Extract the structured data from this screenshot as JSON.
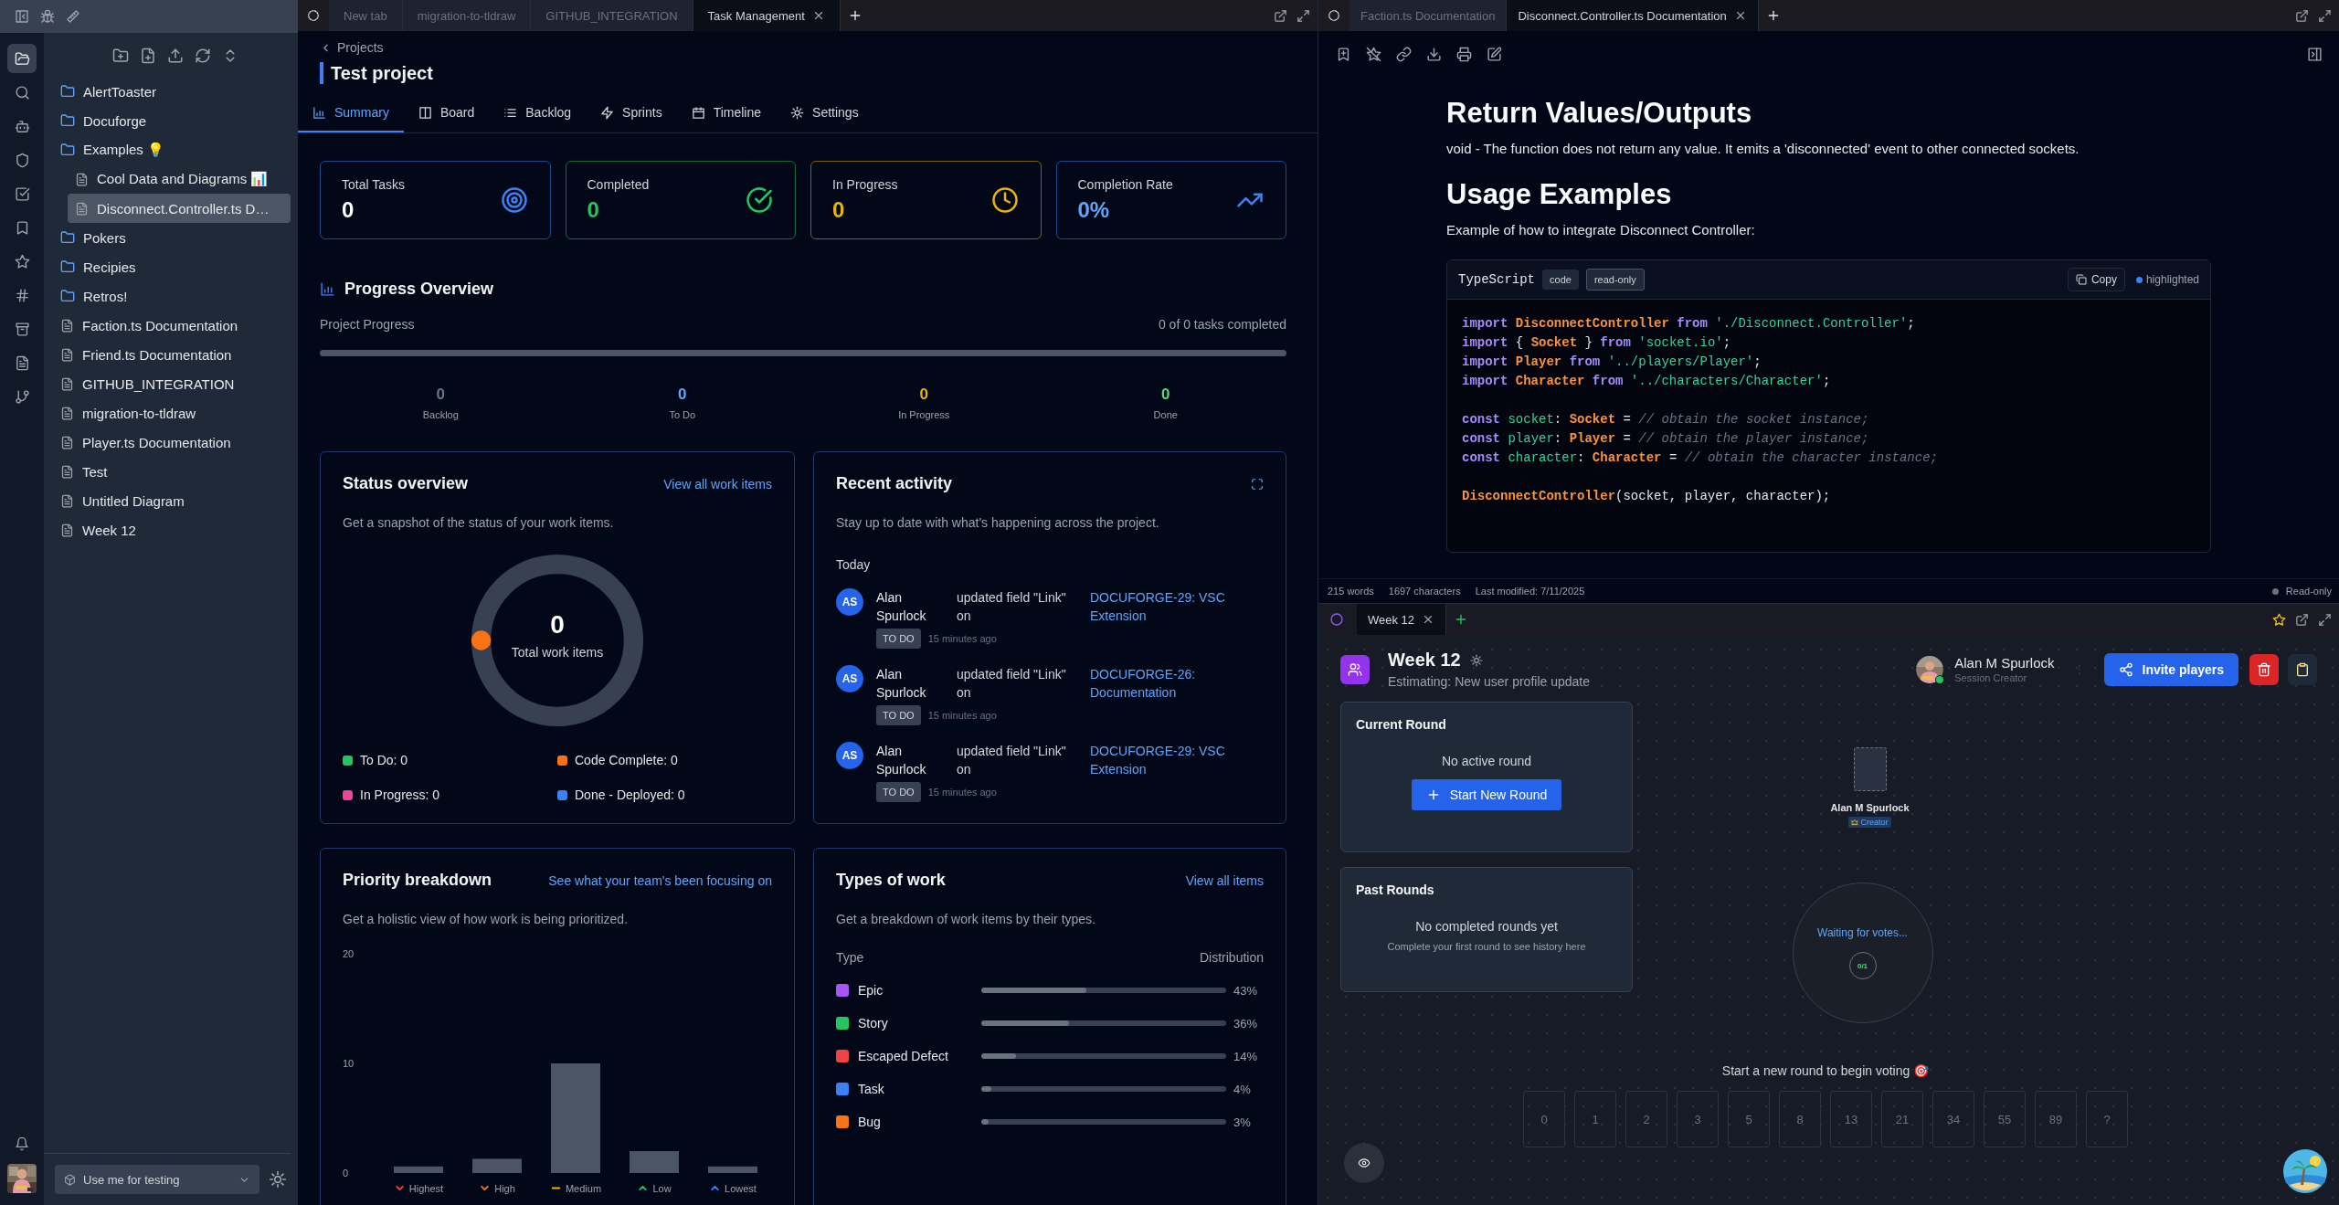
{
  "rail_items": [
    {
      "kind": "files",
      "selected": true
    },
    {
      "kind": "search",
      "selected": false
    },
    {
      "kind": "bot",
      "selected": false
    },
    {
      "kind": "shield",
      "selected": false
    },
    {
      "kind": "tasks",
      "selected": false
    },
    {
      "kind": "bookmark",
      "selected": false
    },
    {
      "kind": "star",
      "selected": false
    },
    {
      "kind": "tags",
      "selected": false
    },
    {
      "kind": "archive",
      "selected": false
    },
    {
      "kind": "document",
      "selected": false
    },
    {
      "kind": "branch",
      "selected": false
    }
  ],
  "sidebar": {
    "tree": [
      {
        "label": "AlertToaster",
        "kind": "folder",
        "selected": false
      },
      {
        "label": "Docuforge",
        "kind": "folder",
        "selected": false
      },
      {
        "label": "Examples 💡",
        "kind": "folder",
        "selected": false,
        "children": [
          {
            "label": "Cool Data and Diagrams 📊",
            "kind": "file",
            "selected": false
          },
          {
            "label": "Disconnect.Controller.ts D…",
            "kind": "file",
            "selected": true
          }
        ]
      },
      {
        "label": "Pokers",
        "kind": "folder",
        "selected": false
      },
      {
        "label": "Recipies",
        "kind": "folder",
        "selected": false
      },
      {
        "label": "Retros!",
        "kind": "folder",
        "selected": false
      },
      {
        "label": "Faction.ts Documentation",
        "kind": "file",
        "selected": false
      },
      {
        "label": "Friend.ts Documentation",
        "kind": "file",
        "selected": false
      },
      {
        "label": "GITHUB_INTEGRATION",
        "kind": "file",
        "selected": false
      },
      {
        "label": "migration-to-tldraw",
        "kind": "file",
        "selected": false
      },
      {
        "label": "Player.ts Documentation",
        "kind": "file",
        "selected": false
      },
      {
        "label": "Test",
        "kind": "file",
        "selected": false
      },
      {
        "label": "Untitled Diagram",
        "kind": "file",
        "selected": false
      },
      {
        "label": "Week 12",
        "kind": "file",
        "selected": false
      }
    ],
    "workspace": "Use me for testing"
  },
  "task_pane": {
    "tabs": [
      {
        "label": "New tab",
        "selected": false
      },
      {
        "label": "migration-to-tldraw",
        "selected": false
      },
      {
        "label": "GITHUB_INTEGRATION",
        "selected": false
      },
      {
        "label": "Task Management",
        "selected": true
      }
    ],
    "breadcrumb": "Projects",
    "title": "Test project",
    "nav": [
      {
        "label": "Summary",
        "kind": "chart",
        "selected": true
      },
      {
        "label": "Board",
        "kind": "board",
        "selected": false
      },
      {
        "label": "Backlog",
        "kind": "list",
        "selected": false
      },
      {
        "label": "Sprints",
        "kind": "zap",
        "selected": false
      },
      {
        "label": "Timeline",
        "kind": "calendar",
        "selected": false
      },
      {
        "label": "Settings",
        "kind": "gear",
        "selected": false
      }
    ],
    "stats": [
      {
        "label": "Total Tasks",
        "value": "0",
        "kind": "target",
        "color": "#3b82f6"
      },
      {
        "label": "Completed",
        "value": "0",
        "kind": "check",
        "color": "#22c55e"
      },
      {
        "label": "In Progress",
        "value": "0",
        "kind": "clock",
        "color": "#eab308"
      },
      {
        "label": "Completion Rate",
        "value": "0%",
        "kind": "trend",
        "color": "#3b82f6"
      }
    ],
    "progress": {
      "title": "Progress Overview",
      "label": "Project Progress",
      "summary": "0 of 0 tasks completed",
      "level": 0,
      "counts": [
        {
          "value": "0",
          "label": "Backlog",
          "color": "#6b7280"
        },
        {
          "value": "0",
          "label": "To Do",
          "color": "#60a5fa"
        },
        {
          "value": "0",
          "label": "In Progress",
          "color": "#eab308"
        },
        {
          "value": "0",
          "label": "Done",
          "color": "#4ade80"
        }
      ]
    },
    "status_overview": {
      "title": "Status overview",
      "link": "View all work items",
      "subtitle": "Get a snapshot of the status of your work items.",
      "total": "0",
      "total_label": "Total work items",
      "legend": [
        {
          "label": "To Do: 0",
          "color": "#22c55e"
        },
        {
          "label": "Code Complete: 0",
          "color": "#f97316"
        },
        {
          "label": "In Progress: 0",
          "color": "#ec4899"
        },
        {
          "label": "Done - Deployed: 0",
          "color": "#3b82f6"
        }
      ]
    },
    "recent_activity": {
      "title": "Recent activity",
      "subtitle": "Stay up to date with what's happening across the project.",
      "day": "Today",
      "items": [
        {
          "initials": "AS",
          "user": "Alan Spurlock",
          "action": "updated field \"Link\" on",
          "target": "DOCUFORGE-29: VSC Extension",
          "status": "TO DO",
          "time": "15 minutes ago"
        },
        {
          "initials": "AS",
          "user": "Alan Spurlock",
          "action": "updated field \"Link\" on",
          "target": "DOCUFORGE-26: Documentation",
          "status": "TO DO",
          "time": "15 minutes ago"
        },
        {
          "initials": "AS",
          "user": "Alan Spurlock",
          "action": "updated field \"Link\" on",
          "target": "DOCUFORGE-29: VSC Extension",
          "status": "TO DO",
          "time": "15 minutes ago"
        }
      ]
    },
    "priority_breakdown": {
      "title": "Priority breakdown",
      "link": "See what your team's been focusing on",
      "subtitle": "Get a holistic view of how work is being prioritized.",
      "chart_data": {
        "type": "bar",
        "categories": [
          "Highest",
          "High",
          "Medium",
          "Low",
          "Lowest"
        ],
        "values": [
          0.6,
          1.3,
          10,
          2,
          0.6
        ],
        "ylim": [
          0,
          20
        ],
        "yticks": [
          0,
          10,
          20
        ]
      },
      "markers": [
        {
          "kind": "down",
          "color": "#ef4444"
        },
        {
          "kind": "down",
          "color": "#f97316"
        },
        {
          "kind": "flat",
          "color": "#eab308"
        },
        {
          "kind": "up",
          "color": "#22c55e"
        },
        {
          "kind": "up",
          "color": "#3b82f6"
        }
      ]
    },
    "types_of_work": {
      "title": "Types of work",
      "link": "View all items",
      "subtitle": "Get a breakdown of work items by their types.",
      "type_heading": "Type",
      "distribution_heading": "Distribution",
      "rows": [
        {
          "label": "Epic",
          "color": "#a855f7",
          "level": 0.43,
          "reading": "43%"
        },
        {
          "label": "Story",
          "color": "#22c55e",
          "level": 0.36,
          "reading": "36%"
        },
        {
          "label": "Escaped Defect",
          "color": "#ef4444",
          "level": 0.14,
          "reading": "14%"
        },
        {
          "label": "Task",
          "color": "#3b82f6",
          "level": 0.04,
          "reading": "4%"
        },
        {
          "label": "Bug",
          "color": "#f97316",
          "level": 0.03,
          "reading": "3%"
        }
      ]
    }
  },
  "doc_pane": {
    "tabs": [
      {
        "label": "Faction.ts Documentation",
        "selected": false
      },
      {
        "label": "Disconnect.Controller.ts Documentation",
        "selected": true
      }
    ],
    "blocks": [
      {
        "kind": "heading",
        "text": "Return Values/Outputs"
      },
      {
        "kind": "paragraph",
        "text": "void - The function does not return any value. It emits a 'disconnected' event to other connected sockets."
      },
      {
        "kind": "heading",
        "text": "Usage Examples"
      },
      {
        "kind": "paragraph",
        "text": "Example of how to integrate Disconnect Controller:"
      }
    ],
    "code": {
      "language": "TypeScript",
      "badges": [
        {
          "label": "code",
          "kind": "filled"
        },
        {
          "label": "read-only",
          "kind": "outlined"
        }
      ],
      "copy": "Copy",
      "status": "highlighted",
      "groups": [
        [
          [
            {
              "kind": "keyword",
              "text": "import "
            },
            {
              "kind": "type",
              "text": "DisconnectController "
            },
            {
              "kind": "keyword",
              "text": "from "
            },
            {
              "kind": "string",
              "text": "'./Disconnect.Controller'"
            },
            {
              "kind": "plain",
              "text": ";"
            }
          ],
          [
            {
              "kind": "keyword",
              "text": "import"
            },
            {
              "kind": "plain",
              "text": " { "
            },
            {
              "kind": "type",
              "text": "Socket"
            },
            {
              "kind": "plain",
              "text": " } "
            },
            {
              "kind": "keyword",
              "text": "from "
            },
            {
              "kind": "string",
              "text": "'socket.io'"
            },
            {
              "kind": "plain",
              "text": ";"
            }
          ],
          [
            {
              "kind": "keyword",
              "text": "import "
            },
            {
              "kind": "type",
              "text": "Player "
            },
            {
              "kind": "keyword",
              "text": "from "
            },
            {
              "kind": "string",
              "text": "'../players/Player'"
            },
            {
              "kind": "plain",
              "text": ";"
            }
          ],
          [
            {
              "kind": "keyword",
              "text": "import "
            },
            {
              "kind": "type",
              "text": "Character "
            },
            {
              "kind": "keyword",
              "text": "from "
            },
            {
              "kind": "string",
              "text": "'../characters/Character'"
            },
            {
              "kind": "plain",
              "text": ";"
            }
          ]
        ],
        [
          [
            {
              "kind": "keyword",
              "text": "const "
            },
            {
              "kind": "variable",
              "text": "socket"
            },
            {
              "kind": "plain",
              "text": ": "
            },
            {
              "kind": "type",
              "text": "Socket"
            },
            {
              "kind": "plain",
              "text": " = "
            },
            {
              "kind": "comment",
              "text": "// obtain the socket instance;"
            }
          ],
          [
            {
              "kind": "keyword",
              "text": "const "
            },
            {
              "kind": "variable",
              "text": "player"
            },
            {
              "kind": "plain",
              "text": ": "
            },
            {
              "kind": "type",
              "text": "Player"
            },
            {
              "kind": "plain",
              "text": " = "
            },
            {
              "kind": "comment",
              "text": "// obtain the player instance;"
            }
          ],
          [
            {
              "kind": "keyword",
              "text": "const "
            },
            {
              "kind": "variable",
              "text": "character"
            },
            {
              "kind": "plain",
              "text": ": "
            },
            {
              "kind": "type",
              "text": "Character"
            },
            {
              "kind": "plain",
              "text": " = "
            },
            {
              "kind": "comment",
              "text": "// obtain the character instance;"
            }
          ]
        ],
        [
          [
            {
              "kind": "type",
              "text": "DisconnectController"
            },
            {
              "kind": "plain",
              "text": "(socket, player, character);"
            }
          ]
        ]
      ]
    },
    "footer": {
      "words": "215 words",
      "characters": "1697 characters",
      "modified": "Last modified: 7/11/2025",
      "mode": "Read-only"
    }
  },
  "poker_pane": {
    "tabs": [
      {
        "label": "Week 12",
        "selected": true
      }
    ],
    "title": "Week 12",
    "subtitle": "Estimating: New user profile update",
    "host": {
      "name": "Alan M Spurlock",
      "role": "Session Creator",
      "online": true
    },
    "invite": "Invite players",
    "current_round": {
      "title": "Current Round",
      "empty": "No active round",
      "button": "Start New Round"
    },
    "past_rounds": {
      "title": "Past Rounds",
      "empty": "No completed rounds yet",
      "hint": "Complete your first round to see history here"
    },
    "participants": [
      {
        "name": "Alan M Spurlock",
        "badge": "Creator"
      }
    ],
    "waiting": {
      "label": "Waiting for votes...",
      "count": "0/1"
    },
    "prompt": "Start a new round to begin voting 🎯",
    "cards": {
      "disabled": true,
      "values": [
        "0",
        "1",
        "2",
        "3",
        "5",
        "8",
        "13",
        "21",
        "34",
        "55",
        "89",
        "?"
      ]
    }
  }
}
